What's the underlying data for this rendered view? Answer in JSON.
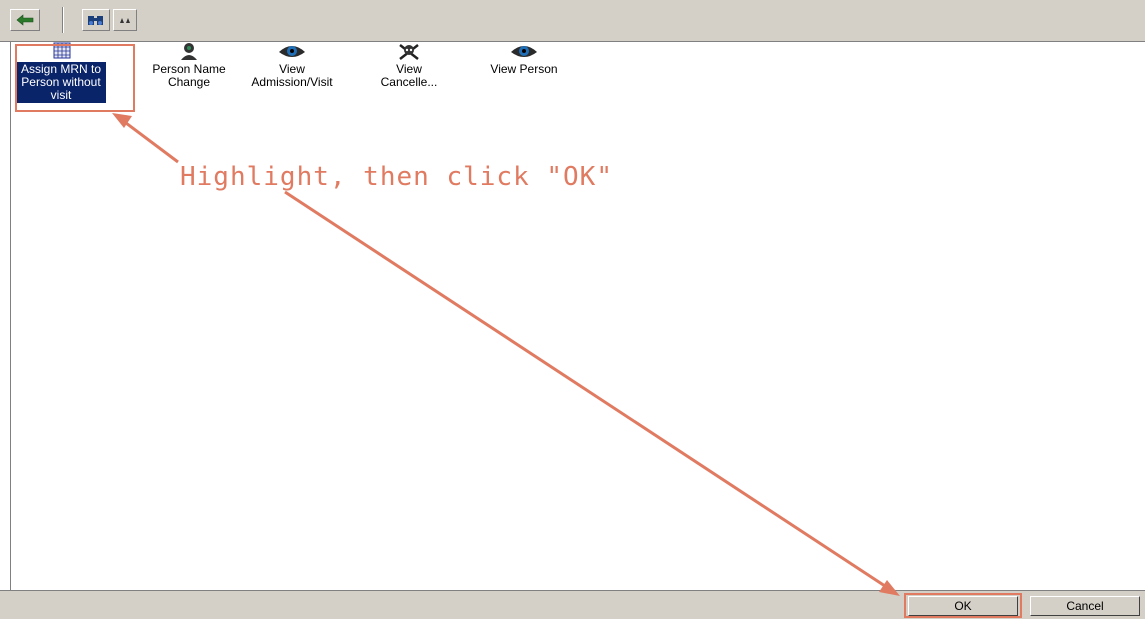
{
  "toolbar": {
    "buttons": [
      {
        "icon": "back-arrow-icon"
      },
      {
        "icon": "binoculars-icon"
      },
      {
        "icon": "up-arrows-icon"
      }
    ]
  },
  "list": {
    "items": [
      {
        "label": "Assign MRN to Person without visit",
        "icon": "calendar-grid-icon",
        "selected": true
      },
      {
        "label": "Person Name Change",
        "icon": "person-icon",
        "selected": false
      },
      {
        "label": "View Admission/Visit",
        "icon": "eye-icon",
        "selected": false
      },
      {
        "label": "View Cancelle...",
        "icon": "skull-crossbones-icon",
        "selected": false
      },
      {
        "label": "View Person",
        "icon": "eye-icon",
        "selected": false
      }
    ]
  },
  "annotation": {
    "text": "Highlight, then click \"OK\"",
    "color": "#e07b62"
  },
  "buttons": {
    "ok_label": "OK",
    "cancel_label": "Cancel"
  },
  "colors": {
    "selection": "#0a246a",
    "face": "#d4d0c8"
  }
}
